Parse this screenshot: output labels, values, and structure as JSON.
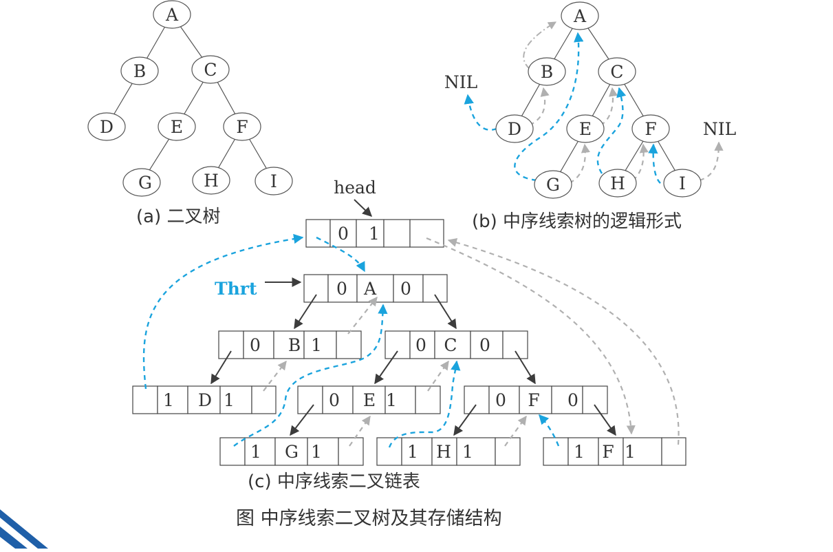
{
  "tree_a": {
    "nodes": [
      "A",
      "B",
      "C",
      "D",
      "E",
      "F",
      "G",
      "H",
      "I"
    ],
    "caption": "(a)   二叉树"
  },
  "tree_b": {
    "nodes": [
      "A",
      "B",
      "C",
      "D",
      "E",
      "F",
      "G",
      "H",
      "I"
    ],
    "nil_left": "NIL",
    "nil_right": "NIL",
    "caption": "(b)   中序线索树的逻辑形式"
  },
  "linked_list": {
    "head_label": "head",
    "thrt_label": "Thrt",
    "head_node": [
      "",
      "0",
      "1",
      "",
      ""
    ],
    "thrt_node": [
      "",
      "0",
      "A",
      "0",
      ""
    ],
    "rows": [
      [
        "",
        "0",
        "B",
        "1",
        ""
      ],
      [
        "",
        "0",
        "C",
        "0",
        ""
      ],
      [
        "",
        "1",
        "D",
        "1",
        ""
      ],
      [
        "",
        "0",
        "E",
        "1",
        ""
      ],
      [
        "",
        "0",
        "F",
        "0",
        ""
      ],
      [
        "",
        "1",
        "G",
        "1",
        ""
      ],
      [
        "",
        "1",
        "H",
        "1",
        ""
      ],
      [
        "",
        "1",
        "F",
        "1",
        ""
      ]
    ],
    "caption": "(c)   中序线索二叉链表"
  },
  "figure_caption": "图   中序线索二叉树及其存储结构",
  "colors": {
    "thread_blue": "#1aa3dd",
    "thread_gray": "#b0b0b0",
    "pointer_dark": "#3c3c3c",
    "corner_blue": "#1f5fa8"
  }
}
